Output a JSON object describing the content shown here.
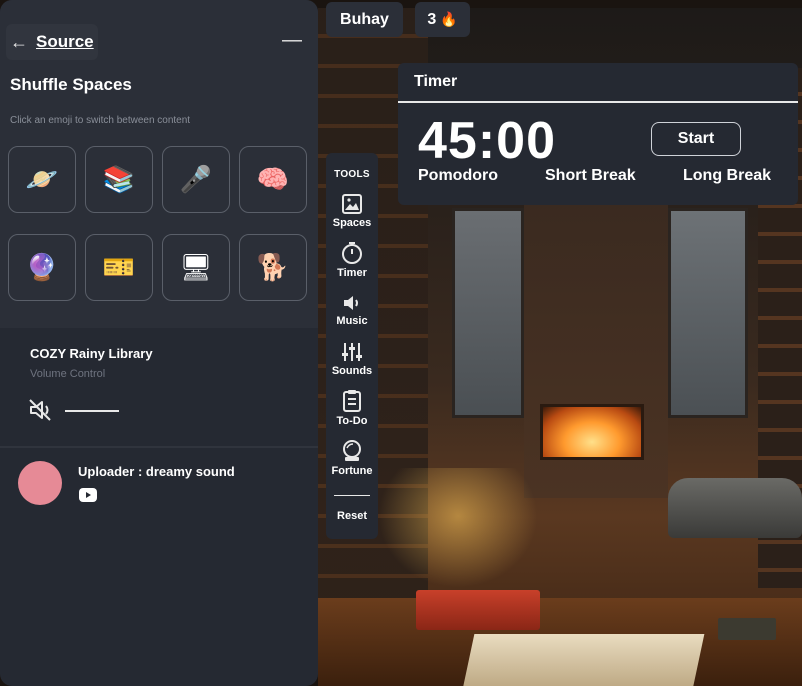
{
  "header": {
    "username": "Buhay",
    "streak_count": "3",
    "streak_icon": "🔥"
  },
  "panel": {
    "back_icon": "←",
    "source_label": "Source",
    "minimize_icon": "—",
    "title": "Shuffle Spaces",
    "hint": "Click an emoji to switch between content",
    "emojis": [
      {
        "glyph": "🪐",
        "name": "planet"
      },
      {
        "glyph": "📚",
        "name": "books"
      },
      {
        "glyph": "🎤",
        "name": "microphone"
      },
      {
        "glyph": "🧠",
        "name": "brain"
      },
      {
        "glyph": "🔮",
        "name": "crystal-ball"
      },
      {
        "glyph": "🎫",
        "name": "ticket"
      },
      {
        "glyph": "🖥",
        "name": "monitor"
      },
      {
        "glyph": "🐕",
        "name": "dog"
      }
    ],
    "now_playing": {
      "title": "COZY Rainy Library",
      "subtitle": "Volume Control",
      "muted": true,
      "volume": 0
    },
    "uploader": {
      "text": "Uploader : dreamy sound",
      "avatar_color": "#e68a96"
    }
  },
  "tools": {
    "label": "TOOLS",
    "items": [
      {
        "label": "Spaces",
        "icon": "image-icon"
      },
      {
        "label": "Timer",
        "icon": "stopwatch-icon"
      },
      {
        "label": "Music",
        "icon": "speaker-icon"
      },
      {
        "label": "Sounds",
        "icon": "sliders-icon"
      },
      {
        "label": "To-Do",
        "icon": "clipboard-icon"
      },
      {
        "label": "Fortune",
        "icon": "crystal-ball-icon"
      }
    ],
    "reset_label": "Reset"
  },
  "timer": {
    "title": "Timer",
    "time": "45:00",
    "start_label": "Start",
    "modes": [
      "Pomodoro",
      "Short Break",
      "Long Break"
    ]
  },
  "colors": {
    "panel_bg": "#252932",
    "panel_top_bg": "#2b2f38",
    "text": "#ffffff",
    "muted_text": "#8a8f99"
  }
}
